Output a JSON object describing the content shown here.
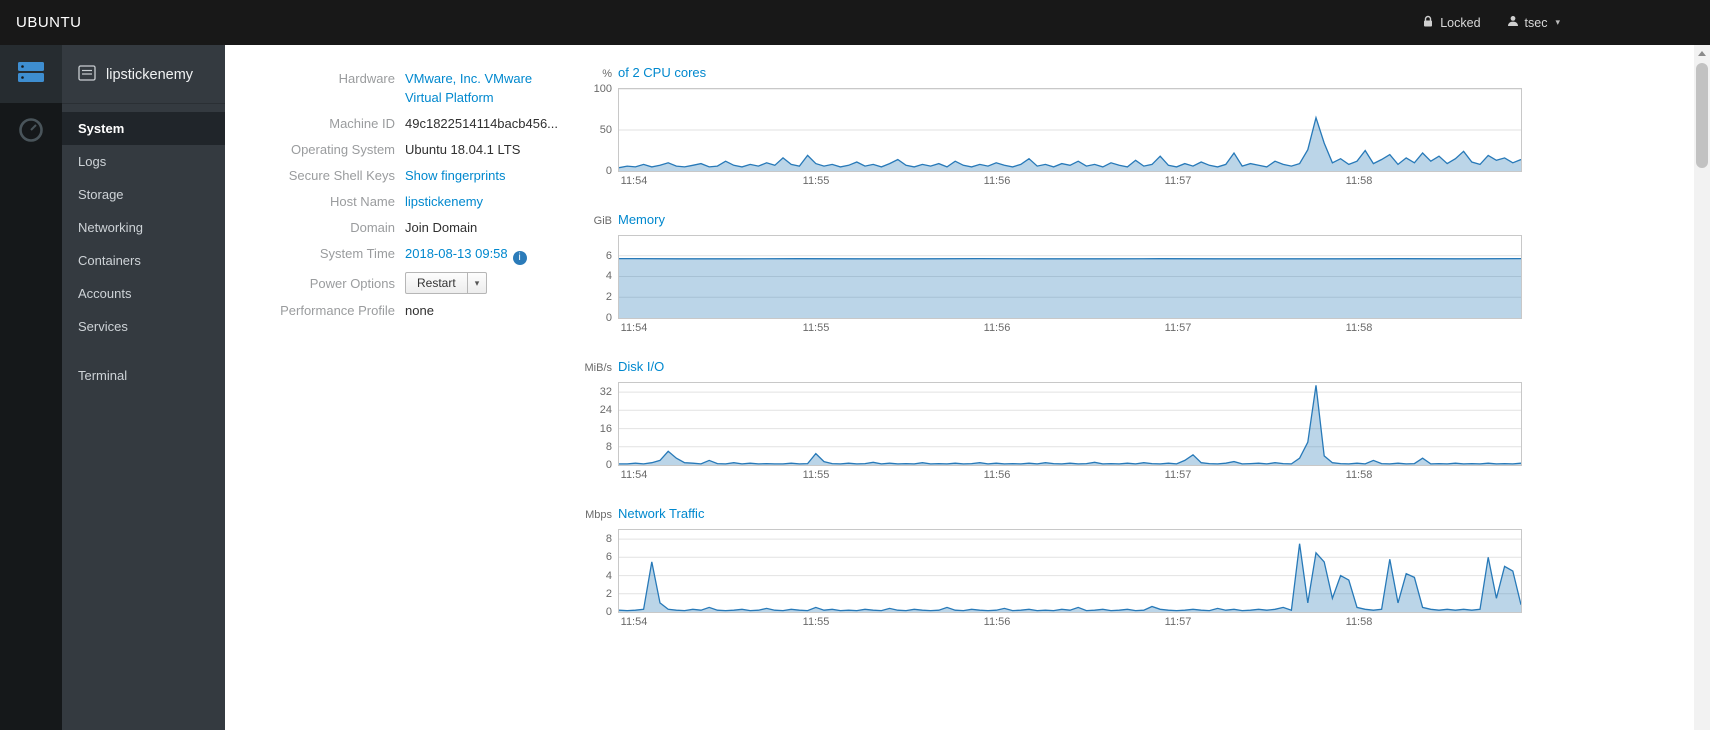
{
  "topbar": {
    "brand": "UBUNTU",
    "locked_label": "Locked",
    "user": "tsec"
  },
  "sidebar": {
    "host": "lipstickenemy",
    "items": [
      {
        "label": "System",
        "active": true
      },
      {
        "label": "Logs",
        "active": false
      },
      {
        "label": "Storage",
        "active": false
      },
      {
        "label": "Networking",
        "active": false
      },
      {
        "label": "Containers",
        "active": false
      },
      {
        "label": "Accounts",
        "active": false
      },
      {
        "label": "Services",
        "active": false
      }
    ],
    "tools": [
      {
        "label": "Terminal"
      }
    ]
  },
  "system": {
    "rows": [
      {
        "label": "Hardware",
        "value": "VMware, Inc. VMware Virtual Platform",
        "kind": "link"
      },
      {
        "label": "Machine ID",
        "value": "49c1822514114bacb456...",
        "kind": "text"
      },
      {
        "label": "Operating System",
        "value": "Ubuntu 18.04.1 LTS",
        "kind": "text"
      },
      {
        "label": "Secure Shell Keys",
        "value": "Show fingerprints",
        "kind": "link"
      },
      {
        "label": "Host Name",
        "value": "lipstickenemy",
        "kind": "link"
      },
      {
        "label": "Domain",
        "value": "Join Domain",
        "kind": "text"
      },
      {
        "label": "System Time",
        "value": "2018-08-13 09:58",
        "kind": "link-info"
      },
      {
        "label": "Power Options",
        "value": "Restart",
        "kind": "button"
      },
      {
        "label": "Performance Profile",
        "value": "none",
        "kind": "text"
      }
    ],
    "info_icon": "i",
    "restart_caret": "▾"
  },
  "chart_data": [
    {
      "type": "area",
      "unit": "%",
      "title": "of 2 CPU cores",
      "ylabel": "% of 2 CPU cores",
      "yticks": [
        0,
        50,
        100
      ],
      "ymax": 100,
      "xticks": [
        "11:54",
        "11:55",
        "11:56",
        "11:57",
        "11:58"
      ],
      "xtick_frac": [
        0.018,
        0.219,
        0.42,
        0.621,
        0.822
      ],
      "values": [
        4,
        6,
        5,
        8,
        5,
        7,
        10,
        6,
        5,
        7,
        9,
        5,
        6,
        12,
        7,
        5,
        8,
        6,
        10,
        7,
        16,
        8,
        6,
        19,
        9,
        6,
        8,
        5,
        7,
        11,
        6,
        8,
        5,
        9,
        14,
        7,
        5,
        8,
        6,
        9,
        5,
        12,
        7,
        5,
        8,
        6,
        10,
        7,
        5,
        8,
        15,
        6,
        8,
        5,
        9,
        7,
        12,
        6,
        8,
        5,
        10,
        7,
        5,
        13,
        6,
        8,
        18,
        7,
        5,
        9,
        6,
        11,
        7,
        5,
        8,
        22,
        6,
        9,
        7,
        5,
        12,
        8,
        6,
        9,
        26,
        65,
        34,
        10,
        15,
        8,
        12,
        25,
        9,
        14,
        20,
        8,
        16,
        10,
        22,
        12,
        18,
        9,
        15,
        24,
        11,
        8,
        19,
        13,
        16,
        10,
        14
      ]
    },
    {
      "type": "area",
      "unit": "GiB",
      "title": "Memory",
      "ylabel": "Memory (GiB)",
      "yticks": [
        0,
        2,
        4,
        6
      ],
      "ymax": 7.9,
      "xticks": [
        "11:54",
        "11:55",
        "11:56",
        "11:57",
        "11:58"
      ],
      "xtick_frac": [
        0.018,
        0.219,
        0.42,
        0.621,
        0.822
      ],
      "values": [
        5.72,
        5.7,
        5.7,
        5.71,
        5.7,
        5.7,
        5.72,
        5.7,
        5.7,
        5.71,
        5.7,
        5.7,
        5.7,
        5.71,
        5.7,
        5.72
      ]
    },
    {
      "type": "area",
      "unit": "MiB/s",
      "title": "Disk I/O",
      "ylabel": "Disk I/O (MiB/s)",
      "yticks": [
        0,
        8,
        16,
        24,
        32
      ],
      "ymax": 36,
      "xticks": [
        "11:54",
        "11:55",
        "11:56",
        "11:57",
        "11:58"
      ],
      "xtick_frac": [
        0.018,
        0.219,
        0.42,
        0.621,
        0.822
      ],
      "values": [
        0.5,
        0.5,
        0.8,
        0.5,
        1,
        2,
        6,
        3,
        1,
        0.8,
        0.5,
        2,
        0.6,
        0.5,
        1,
        0.5,
        0.8,
        0.5,
        0.6,
        0.5,
        0.5,
        0.8,
        0.5,
        0.6,
        5,
        1.5,
        0.6,
        0.5,
        0.8,
        0.5,
        0.6,
        1.2,
        0.5,
        0.8,
        0.5,
        0.6,
        0.5,
        1,
        0.5,
        0.6,
        0.5,
        0.8,
        0.5,
        0.6,
        1,
        0.5,
        0.8,
        0.5,
        0.6,
        0.5,
        0.8,
        0.5,
        1,
        0.6,
        0.5,
        0.8,
        0.5,
        0.6,
        1.2,
        0.5,
        0.6,
        0.5,
        0.8,
        0.5,
        1,
        0.6,
        0.5,
        0.8,
        0.5,
        2,
        4.5,
        1,
        0.6,
        0.5,
        0.8,
        1.5,
        0.5,
        0.6,
        0.8,
        0.5,
        1,
        0.6,
        0.5,
        3,
        10,
        35,
        4,
        1,
        0.6,
        0.5,
        0.8,
        0.5,
        2,
        0.6,
        0.5,
        0.8,
        0.5,
        0.6,
        3,
        0.5,
        0.6,
        0.5,
        0.8,
        0.5,
        0.6,
        0.5,
        0.8,
        0.5,
        0.6,
        0.5,
        0.8
      ]
    },
    {
      "type": "area",
      "unit": "Mbps",
      "title": "Network Traffic",
      "ylabel": "Network Traffic (Mbps)",
      "yticks": [
        0,
        2,
        4,
        6,
        8
      ],
      "ymax": 9,
      "xticks": [
        "11:54",
        "11:55",
        "11:56",
        "11:57",
        "11:58"
      ],
      "xtick_frac": [
        0.018,
        0.219,
        0.42,
        0.621,
        0.822
      ],
      "values": [
        0.2,
        0.15,
        0.2,
        0.3,
        5.5,
        1,
        0.3,
        0.2,
        0.15,
        0.3,
        0.2,
        0.5,
        0.2,
        0.15,
        0.2,
        0.3,
        0.15,
        0.2,
        0.4,
        0.2,
        0.15,
        0.3,
        0.2,
        0.15,
        0.5,
        0.2,
        0.3,
        0.15,
        0.2,
        0.15,
        0.3,
        0.2,
        0.15,
        0.4,
        0.2,
        0.15,
        0.3,
        0.2,
        0.15,
        0.2,
        0.5,
        0.2,
        0.15,
        0.3,
        0.2,
        0.15,
        0.2,
        0.4,
        0.15,
        0.2,
        0.3,
        0.15,
        0.2,
        0.15,
        0.3,
        0.2,
        0.5,
        0.15,
        0.2,
        0.3,
        0.15,
        0.2,
        0.3,
        0.15,
        0.2,
        0.6,
        0.3,
        0.2,
        0.15,
        0.2,
        0.3,
        0.2,
        0.15,
        0.4,
        0.2,
        0.3,
        0.15,
        0.2,
        0.3,
        0.2,
        0.3,
        0.5,
        0.2,
        7.5,
        1,
        6.5,
        5.5,
        1.5,
        4,
        3.5,
        0.5,
        0.3,
        0.2,
        0.3,
        5.8,
        1,
        4.2,
        3.8,
        0.5,
        0.3,
        0.2,
        0.3,
        0.2,
        0.3,
        0.2,
        0.3,
        6,
        1.5,
        5,
        4.5,
        0.8
      ]
    }
  ]
}
